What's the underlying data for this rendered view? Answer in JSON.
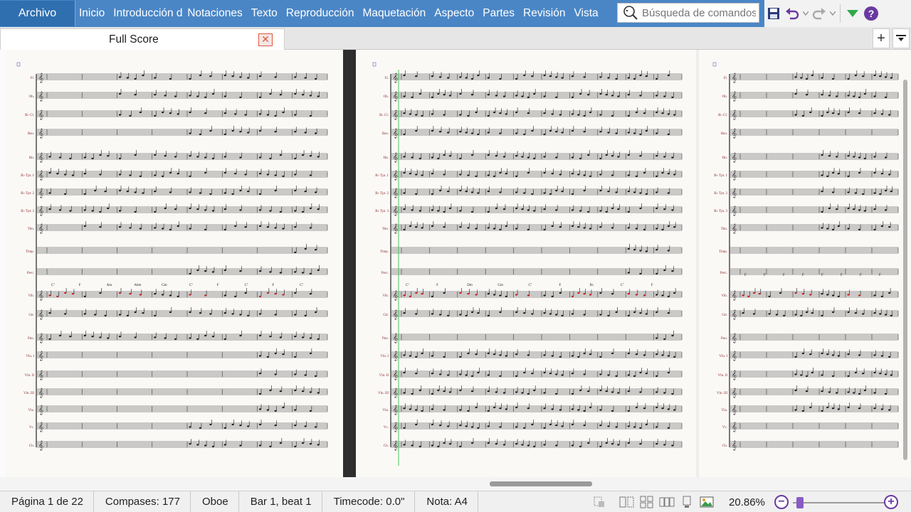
{
  "ribbon": {
    "archivo": "Archivo",
    "tabs": [
      "Inicio",
      "Introducción d",
      "Notaciones",
      "Texto",
      "Reproducción",
      "Maquetación",
      "Aspecto",
      "Partes",
      "Revisión",
      "Vista"
    ],
    "search_placeholder": "Búsqueda de comandos"
  },
  "doc": {
    "tab_title": "Full Score",
    "close_glyph": "✕",
    "add_view_glyph": "+"
  },
  "status": {
    "page": "Página 1 de 22",
    "bars": "Compases: 177",
    "instrument": "Oboe",
    "position": "Bar 1, beat 1",
    "timecode": "Timecode: 0.0\"",
    "note": "Nota: A4",
    "zoom": "20.86%",
    "zoom_level": 0.21
  },
  "score": {
    "page1_instruments": [
      "Fl.",
      "Ob.",
      "B♭ Cl.",
      "Bsn.",
      "Hn.",
      "B♭ Tpt. 1",
      "B♭ Tpt. 2",
      "B♭ Tpt. 3",
      "Tbn.",
      "Timp.",
      "Perc.",
      "Vib.",
      "Gtr.",
      "Pno.",
      "Vln. I",
      "Vln. II",
      "Vln. III",
      "Vla.",
      "Vc.",
      "Cb."
    ],
    "page2_instruments": [
      "Fl.",
      "Ob.",
      "B♭ Cl.",
      "Bsn.",
      "Hn.",
      "B♭ Tpt. 1",
      "B♭ Tpt. 2",
      "B♭ Tpt. 3",
      "Tbn.",
      "Timp.",
      "Perc.",
      "Vib.",
      "Gtr.",
      "Pno.",
      "Vln. I",
      "Vln. II",
      "Vln. III",
      "Vla.",
      "Vc.",
      "Cb."
    ],
    "page3_instruments": [
      "Fl.",
      "Ob.",
      "B♭ Cl.",
      "Bsn.",
      "Hn.",
      "B♭ Tpt. 1",
      "B♭ Tpt. 2",
      "B♭ Tpt. 3",
      "Tbn.",
      "Timp.",
      "Perc.",
      "Vib.",
      "Gtr.",
      "Pno.",
      "Vln. I",
      "Vln. II",
      "Vln. III",
      "Vla.",
      "Vc.",
      "Cb."
    ],
    "chords_p1": [
      "C⁷",
      "F",
      "Am",
      "Abm",
      "Gm",
      "C⁷",
      "F",
      "C⁷",
      "F",
      "C⁷"
    ],
    "chords_p2": [
      "C⁷",
      "F",
      "Dm",
      "Gm",
      "C⁷",
      "F",
      "B♭",
      "C⁷",
      "F"
    ],
    "chords_p3": [
      "F",
      "F",
      "F",
      "F",
      "F",
      "F",
      "F",
      "F"
    ],
    "colors": {
      "staff": "#3a3a3a",
      "note": "#1a1a1a",
      "red_note": "#d01818",
      "green_line": "#49c35a",
      "instrument_label": "#8a2a2a"
    }
  }
}
